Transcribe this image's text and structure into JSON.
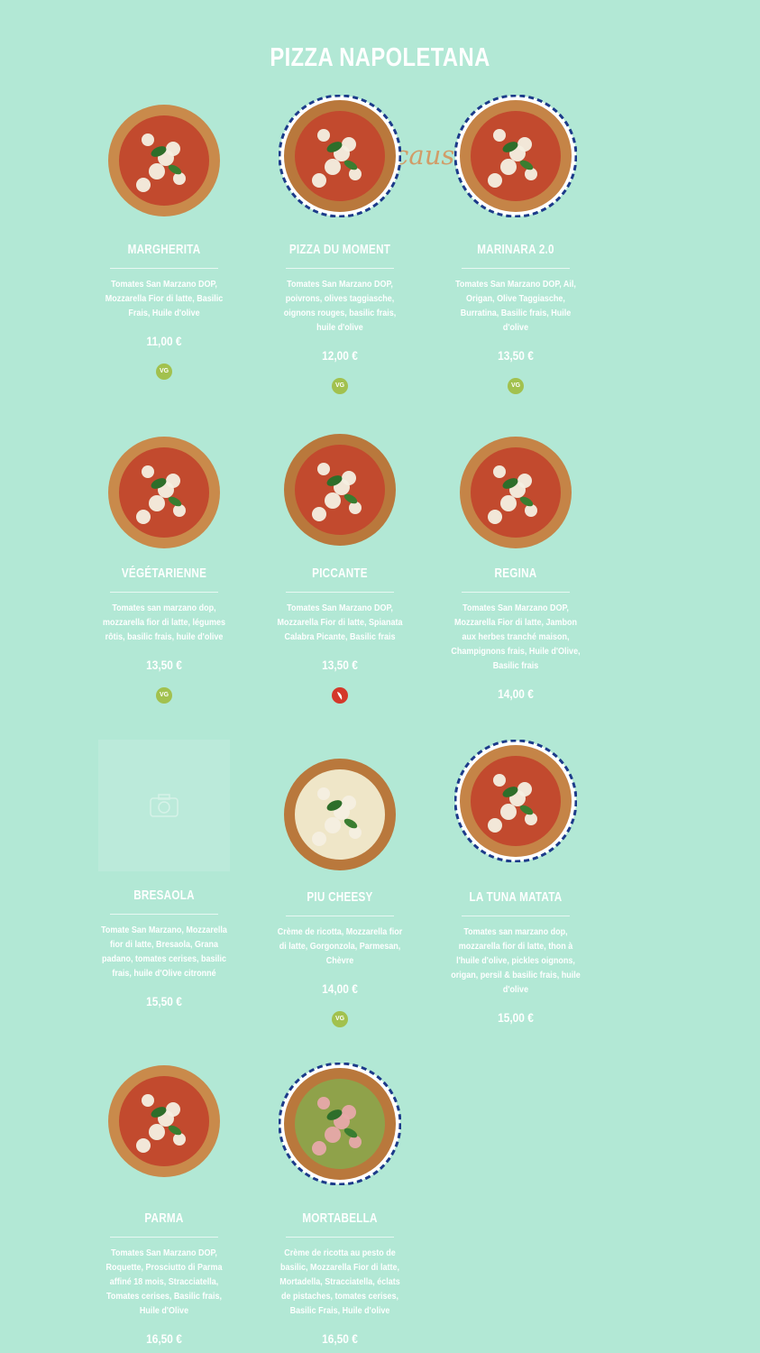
{
  "page": {
    "title": "PIZZA NAPOLETANA",
    "watermark": "ecaust.fr"
  },
  "colors": {
    "background": "#b2e8d5",
    "veg_badge": "#a2c14e",
    "spicy_badge": "#d4382a"
  },
  "pizzas": [
    {
      "name": "MARGHERITA",
      "description": "Tomates San Marzano DOP, Mozzarella Fior di latte, Basilic Frais, Huile d'olive",
      "price": "11,00 €",
      "badge": "VG",
      "badge_type": "vg",
      "image": "pizza-margherita"
    },
    {
      "name": "PIZZA DU MOMENT",
      "description": "Tomates San Marzano DOP, poivrons, olives taggiasche, oignons rouges, basilic frais, huile d'olive",
      "price": "12,00 €",
      "badge": "VG",
      "badge_type": "vg",
      "image": "pizza-du-moment"
    },
    {
      "name": "MARINARA 2.0",
      "description": "Tomates San Marzano DOP, Ail, Origan, Olive Taggiasche, Burratina, Basilic frais, Huile d'olive",
      "price": "13,50 €",
      "badge": "VG",
      "badge_type": "vg",
      "image": "pizza-marinara"
    },
    {
      "name": "VÉGÉTARIENNE",
      "description": "Tomates san marzano dop, mozzarella fior di latte, légumes rôtis, basilic frais, huile d'olive",
      "price": "13,50 €",
      "badge": "VG",
      "badge_type": "vg",
      "image": "pizza-vegetarienne"
    },
    {
      "name": "PICCANTE",
      "description": "Tomates San Marzano DOP, Mozzarella Fior di latte, Spianata Calabra Picante, Basilic frais",
      "price": "13,50 €",
      "badge": "",
      "badge_type": "spicy",
      "badge_icon": "chili-pepper-icon",
      "image": "pizza-piccante"
    },
    {
      "name": "REGINA",
      "description": "Tomates San Marzano DOP, Mozzarella Fior di latte, Jambon aux herbes tranché maison, Champignons frais, Huile d'Olive, Basilic frais",
      "price": "14,00 €",
      "badge": "",
      "badge_type": "none",
      "image": "pizza-regina"
    },
    {
      "name": "BRESAOLA",
      "description": "Tomate San Marzano, Mozzarella fior di latte, Bresaola, Grana padano, tomates cerises, basilic frais, huile d'Olive citronné",
      "price": "15,50 €",
      "badge": "",
      "badge_type": "none",
      "image": "camera-placeholder-icon"
    },
    {
      "name": "PIU CHEESY",
      "description": "Crème de ricotta, Mozzarella fior di latte, Gorgonzola, Parmesan, Chèvre",
      "price": "14,00 €",
      "badge": "VG",
      "badge_type": "vg",
      "image": "pizza-piu-cheesy"
    },
    {
      "name": "LA TUNA MATATA",
      "description": "Tomates san marzano dop, mozzarella fior di latte, thon à l'huile d'olive, pickles oignons, origan, persil & basilic frais, huile d'olive",
      "price": "15,00 €",
      "badge": "",
      "badge_type": "none",
      "image": "pizza-tuna-matata"
    },
    {
      "name": "PARMA",
      "description": "Tomates San Marzano DOP, Roquette, Prosciutto di Parma affiné 18 mois, Stracciatella, Tomates cerises, Basilic frais, Huile d'Olive",
      "price": "16,50 €",
      "badge": "",
      "badge_type": "none",
      "image": "pizza-parma"
    },
    {
      "name": "MORTABELLA",
      "description": "Crème de ricotta au pesto de basilic, Mozzarella Fior di latte, Mortadella, Stracciatella, éclats de pistaches, tomates cerises, Basilic Frais, Huile d'olive",
      "price": "16,50 €",
      "badge": "",
      "badge_type": "none",
      "image": "pizza-mortabella"
    }
  ]
}
